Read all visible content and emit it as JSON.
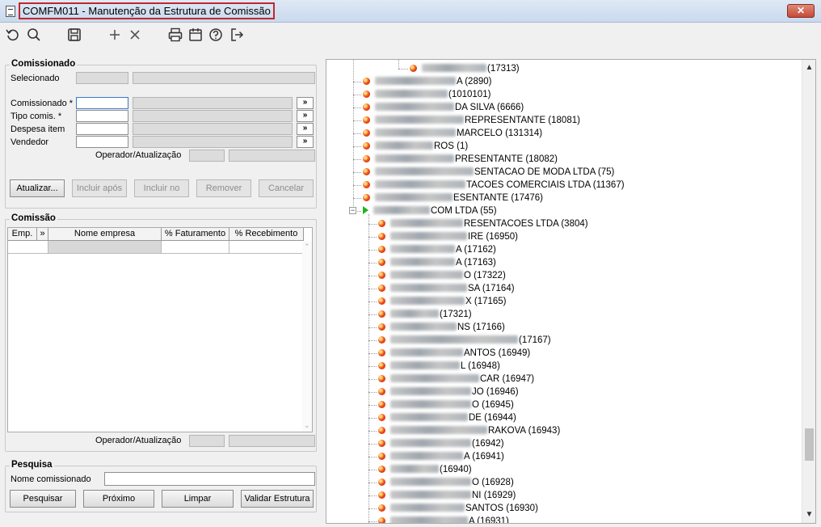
{
  "window": {
    "title": "COMFM011 - Manutenção da Estrutura de Comissão",
    "close_label": "✕"
  },
  "toolbar": {
    "icons": [
      "refresh-icon",
      "search-icon",
      "save-icon",
      "add-icon",
      "delete-icon",
      "print-icon",
      "calendar-icon",
      "help-icon",
      "exit-icon"
    ]
  },
  "comissionado": {
    "group_title": "Comissionado",
    "selecionado_label": "Selecionado",
    "comissionado_label": "Comissionado *",
    "tipo_label": "Tipo comis. *",
    "despesa_label": "Despesa item",
    "vendedor_label": "Vendedor",
    "lookup_glyph": "»",
    "operador_label": "Operador/Atualização",
    "buttons": {
      "atualizar": "Atualizar...",
      "incluir_apos": "Incluir após",
      "incluir_no": "Incluir no",
      "remover": "Remover",
      "cancelar": "Cancelar"
    }
  },
  "comissao": {
    "group_title": "Comissão",
    "columns": [
      "Emp.",
      "»",
      "Nome empresa",
      "% Faturamento",
      "% Recebimento"
    ],
    "operador_label": "Operador/Atualização"
  },
  "pesquisa": {
    "group_title": "Pesquisa",
    "nome_label": "Nome comissionado",
    "nome_value": "",
    "buttons": {
      "pesquisar": "Pesquisar",
      "proximo": "Próximo",
      "limpar": "Limpar",
      "validar": "Validar Estrutura"
    }
  },
  "tree": {
    "nodes": [
      {
        "text": "(17313)",
        "icon": "dot"
      },
      {
        "text": "A (2890)",
        "icon": "dot"
      },
      {
        "text": "(1010101)",
        "icon": "dot"
      },
      {
        "text": "DA SILVA (6666)",
        "icon": "dot"
      },
      {
        "text": "REPRESENTANTE (18081)",
        "icon": "dot"
      },
      {
        "text": "MARCELO (131314)",
        "icon": "dot"
      },
      {
        "text": "ROS (1)",
        "icon": "dot"
      },
      {
        "text": "PRESENTANTE (18082)",
        "icon": "dot"
      },
      {
        "text": "SENTACAO  DE MODA LTDA (75)",
        "icon": "dot"
      },
      {
        "text": "TACOES COMERCIAIS LTDA (11367)",
        "icon": "dot"
      },
      {
        "text": "ESENTANTE (17476)",
        "icon": "dot"
      },
      {
        "text": "COM LTDA (55)",
        "icon": "arrow"
      },
      {
        "text": "RESENTACOES LTDA (3804)",
        "icon": "dot"
      },
      {
        "text": "IRE (16950)",
        "icon": "dot"
      },
      {
        "text": "A (17162)",
        "icon": "dot"
      },
      {
        "text": "A (17163)",
        "icon": "dot"
      },
      {
        "text": "O (17322)",
        "icon": "dot"
      },
      {
        "text": "SA (17164)",
        "icon": "dot"
      },
      {
        "text": "X (17165)",
        "icon": "dot"
      },
      {
        "text": "(17321)",
        "icon": "dot"
      },
      {
        "text": "NS (17166)",
        "icon": "dot"
      },
      {
        "text": "(17167)",
        "icon": "dot"
      },
      {
        "text": "ANTOS (16949)",
        "icon": "dot"
      },
      {
        "text": "L (16948)",
        "icon": "dot"
      },
      {
        "text": "CAR (16947)",
        "icon": "dot"
      },
      {
        "text": "JO (16946)",
        "icon": "dot"
      },
      {
        "text": "O (16945)",
        "icon": "dot"
      },
      {
        "text": "DE (16944)",
        "icon": "dot"
      },
      {
        "text": "RAKOVA (16943)",
        "icon": "dot"
      },
      {
        "text": "(16942)",
        "icon": "dot"
      },
      {
        "text": "A (16941)",
        "icon": "dot"
      },
      {
        "text": "(16940)",
        "icon": "dot"
      },
      {
        "text": "O (16928)",
        "icon": "dot"
      },
      {
        "text": "NI (16929)",
        "icon": "dot"
      },
      {
        "text": "SANTOS (16930)",
        "icon": "dot"
      },
      {
        "text": "A (16931)",
        "icon": "dot"
      }
    ]
  },
  "colors": {
    "title_highlight": "#c0282d",
    "node_dot": "#f25a1d",
    "node_arrow": "#21b323"
  }
}
